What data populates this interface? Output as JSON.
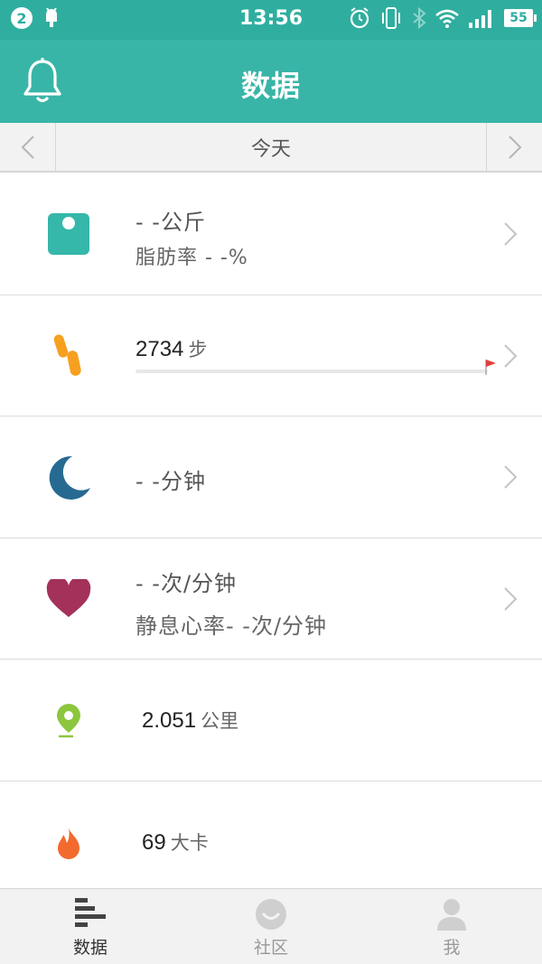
{
  "status_bar": {
    "notification_count": "2",
    "time": "13:56",
    "battery": "55",
    "icons": [
      "android-icon",
      "alarm-icon",
      "vibrate-icon",
      "bluetooth-icon",
      "wifi-icon",
      "signal-icon"
    ]
  },
  "app_bar": {
    "title": "数据",
    "icon": "bell-icon"
  },
  "date_bar": {
    "label": "今天"
  },
  "rows": {
    "weight": {
      "primary": "- -公斤",
      "secondary": "脂肪率 - -%",
      "icon": "scale-icon",
      "color": "#35b7a9"
    },
    "steps": {
      "value": "2734",
      "unit": "步",
      "progress": 0.0,
      "icon": "footsteps-icon",
      "color": "#f7a01f"
    },
    "sleep": {
      "primary": "- -分钟",
      "icon": "moon-icon",
      "color": "#276a91"
    },
    "heart": {
      "primary": "- -次/分钟",
      "secondary": "静息心率- -次/分钟",
      "icon": "heart-icon",
      "color": "#a3315a"
    },
    "distance": {
      "value": "2.051",
      "unit": "公里",
      "icon": "location-pin-icon",
      "color": "#8cc63f"
    },
    "calories": {
      "value": "69",
      "unit": "大卡",
      "icon": "flame-icon",
      "color": "#f26a2e"
    }
  },
  "tabs": [
    {
      "label": "数据",
      "icon": "bars-icon",
      "active": true
    },
    {
      "label": "社区",
      "icon": "chat-bubble-icon",
      "active": false
    },
    {
      "label": "我",
      "icon": "person-icon",
      "active": false
    }
  ]
}
